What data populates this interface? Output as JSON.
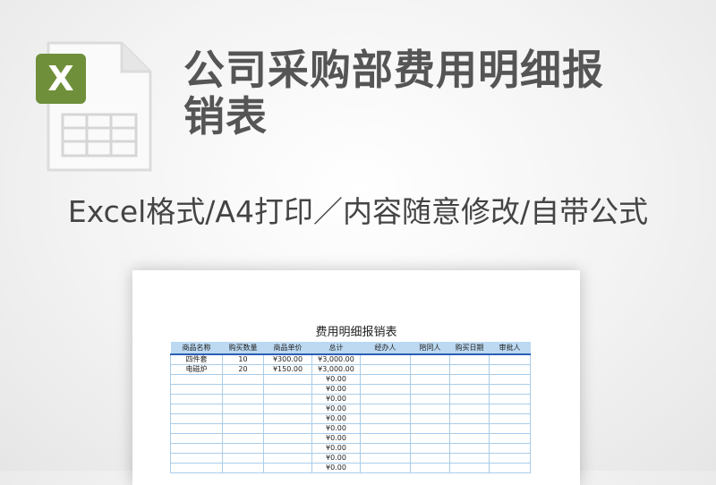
{
  "icon": {
    "name": "excel-file-icon",
    "badge_letter": "X",
    "badge_color": "#6f8f3a"
  },
  "title_line1": "公司采购部费用明细报",
  "title_line2": "销表",
  "subtitle": "Excel格式/A4打印／内容随意修改/自带公式",
  "sheet": {
    "title": "费用明细报销表",
    "headers": [
      "商品名称",
      "购买数量",
      "商品单价",
      "总计",
      "经办人",
      "陪同人",
      "购买日期",
      "审批人"
    ],
    "rows": [
      [
        "四件套",
        "10",
        "¥300.00",
        "¥3,000.00",
        "",
        "",
        "",
        ""
      ],
      [
        "电磁炉",
        "20",
        "¥150.00",
        "¥3,000.00",
        "",
        "",
        "",
        ""
      ],
      [
        "",
        "",
        "",
        "¥0.00",
        "",
        "",
        "",
        ""
      ],
      [
        "",
        "",
        "",
        "¥0.00",
        "",
        "",
        "",
        ""
      ],
      [
        "",
        "",
        "",
        "¥0.00",
        "",
        "",
        "",
        ""
      ],
      [
        "",
        "",
        "",
        "¥0.00",
        "",
        "",
        "",
        ""
      ],
      [
        "",
        "",
        "",
        "¥0.00",
        "",
        "",
        "",
        ""
      ],
      [
        "",
        "",
        "",
        "¥0.00",
        "",
        "",
        "",
        ""
      ],
      [
        "",
        "",
        "",
        "¥0.00",
        "",
        "",
        "",
        ""
      ],
      [
        "",
        "",
        "",
        "¥0.00",
        "",
        "",
        "",
        ""
      ],
      [
        "",
        "",
        "",
        "¥0.00",
        "",
        "",
        "",
        ""
      ],
      [
        "",
        "",
        "",
        "¥0.00",
        "",
        "",
        "",
        ""
      ]
    ]
  }
}
